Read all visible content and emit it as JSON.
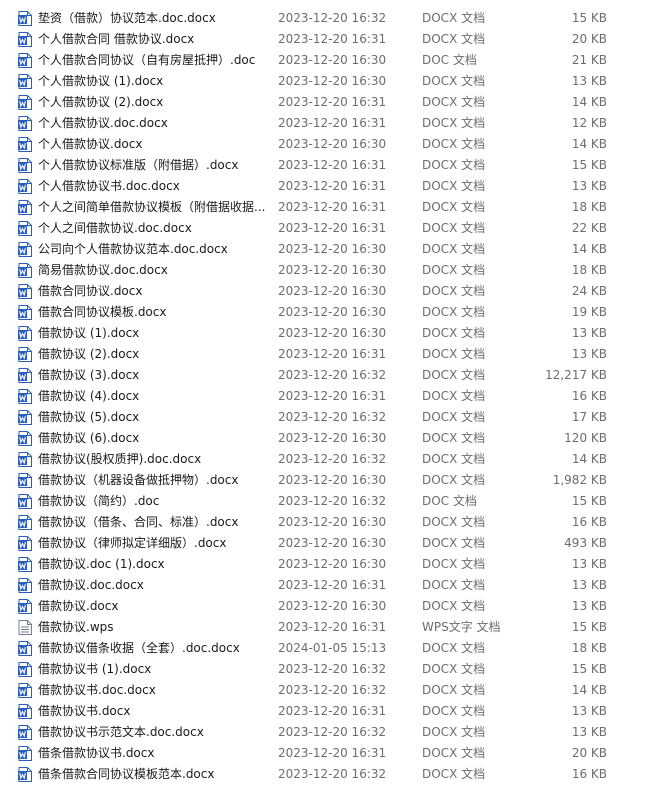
{
  "files": [
    {
      "name": "垫资（借款）协议范本.doc.docx",
      "date": "2023-12-20 16:32",
      "type": "DOCX 文档",
      "size": "15 KB",
      "icon": "word-document-icon"
    },
    {
      "name": "个人借款合同 借款协议.docx",
      "date": "2023-12-20 16:31",
      "type": "DOCX 文档",
      "size": "20 KB",
      "icon": "word-document-icon"
    },
    {
      "name": "个人借款合同协议（自有房屋抵押）.doc",
      "date": "2023-12-20 16:30",
      "type": "DOC 文档",
      "size": "21 KB",
      "icon": "word-document-icon"
    },
    {
      "name": "个人借款协议 (1).docx",
      "date": "2023-12-20 16:30",
      "type": "DOCX 文档",
      "size": "13 KB",
      "icon": "word-document-icon"
    },
    {
      "name": "个人借款协议 (2).docx",
      "date": "2023-12-20 16:31",
      "type": "DOCX 文档",
      "size": "14 KB",
      "icon": "word-document-icon"
    },
    {
      "name": "个人借款协议.doc.docx",
      "date": "2023-12-20 16:31",
      "type": "DOCX 文档",
      "size": "12 KB",
      "icon": "word-document-icon"
    },
    {
      "name": "个人借款协议.docx",
      "date": "2023-12-20 16:30",
      "type": "DOCX 文档",
      "size": "14 KB",
      "icon": "word-document-icon"
    },
    {
      "name": "个人借款协议标准版（附借据）.docx",
      "date": "2023-12-20 16:31",
      "type": "DOCX 文档",
      "size": "15 KB",
      "icon": "word-document-icon"
    },
    {
      "name": "个人借款协议书.doc.docx",
      "date": "2023-12-20 16:31",
      "type": "DOCX 文档",
      "size": "13 KB",
      "icon": "word-document-icon"
    },
    {
      "name": "个人之间简单借款协议模板（附借据收据...",
      "date": "2023-12-20 16:31",
      "type": "DOCX 文档",
      "size": "18 KB",
      "icon": "word-document-icon"
    },
    {
      "name": "个人之间借款协议.doc.docx",
      "date": "2023-12-20 16:31",
      "type": "DOCX 文档",
      "size": "22 KB",
      "icon": "word-document-icon"
    },
    {
      "name": "公司向个人借款协议范本.doc.docx",
      "date": "2023-12-20 16:30",
      "type": "DOCX 文档",
      "size": "14 KB",
      "icon": "word-document-icon"
    },
    {
      "name": "简易借款协议.doc.docx",
      "date": "2023-12-20 16:30",
      "type": "DOCX 文档",
      "size": "18 KB",
      "icon": "word-document-icon"
    },
    {
      "name": "借款合同协议.docx",
      "date": "2023-12-20 16:30",
      "type": "DOCX 文档",
      "size": "24 KB",
      "icon": "word-document-icon"
    },
    {
      "name": "借款合同协议模板.docx",
      "date": "2023-12-20 16:30",
      "type": "DOCX 文档",
      "size": "19 KB",
      "icon": "word-document-icon"
    },
    {
      "name": "借款协议 (1).docx",
      "date": "2023-12-20 16:30",
      "type": "DOCX 文档",
      "size": "13 KB",
      "icon": "word-document-icon"
    },
    {
      "name": "借款协议 (2).docx",
      "date": "2023-12-20 16:31",
      "type": "DOCX 文档",
      "size": "13 KB",
      "icon": "word-document-icon"
    },
    {
      "name": "借款协议 (3).docx",
      "date": "2023-12-20 16:32",
      "type": "DOCX 文档",
      "size": "12,217 KB",
      "icon": "word-document-icon"
    },
    {
      "name": "借款协议 (4).docx",
      "date": "2023-12-20 16:31",
      "type": "DOCX 文档",
      "size": "16 KB",
      "icon": "word-document-icon"
    },
    {
      "name": "借款协议 (5).docx",
      "date": "2023-12-20 16:32",
      "type": "DOCX 文档",
      "size": "17 KB",
      "icon": "word-document-icon"
    },
    {
      "name": "借款协议 (6).docx",
      "date": "2023-12-20 16:30",
      "type": "DOCX 文档",
      "size": "120 KB",
      "icon": "word-document-icon"
    },
    {
      "name": "借款协议(股权质押).doc.docx",
      "date": "2023-12-20 16:32",
      "type": "DOCX 文档",
      "size": "14 KB",
      "icon": "word-document-icon"
    },
    {
      "name": "借款协议（机器设备做抵押物）.docx",
      "date": "2023-12-20 16:30",
      "type": "DOCX 文档",
      "size": "1,982 KB",
      "icon": "word-document-icon"
    },
    {
      "name": "借款协议（简约）.doc",
      "date": "2023-12-20 16:32",
      "type": "DOC 文档",
      "size": "15 KB",
      "icon": "word-document-icon"
    },
    {
      "name": "借款协议（借条、合同、标准）.docx",
      "date": "2023-12-20 16:30",
      "type": "DOCX 文档",
      "size": "16 KB",
      "icon": "word-document-icon"
    },
    {
      "name": "借款协议（律师拟定详细版）.docx",
      "date": "2023-12-20 16:30",
      "type": "DOCX 文档",
      "size": "493 KB",
      "icon": "word-document-icon"
    },
    {
      "name": "借款协议.doc (1).docx",
      "date": "2023-12-20 16:30",
      "type": "DOCX 文档",
      "size": "13 KB",
      "icon": "word-document-icon"
    },
    {
      "name": "借款协议.doc.docx",
      "date": "2023-12-20 16:31",
      "type": "DOCX 文档",
      "size": "13 KB",
      "icon": "word-document-icon"
    },
    {
      "name": "借款协议.docx",
      "date": "2023-12-20 16:30",
      "type": "DOCX 文档",
      "size": "13 KB",
      "icon": "word-document-icon"
    },
    {
      "name": "借款协议.wps",
      "date": "2023-12-20 16:31",
      "type": "WPS文字 文档",
      "size": "15 KB",
      "icon": "text-document-icon"
    },
    {
      "name": "借款协议借条收据（全套）.doc.docx",
      "date": "2024-01-05 15:13",
      "type": "DOCX 文档",
      "size": "18 KB",
      "icon": "word-document-icon"
    },
    {
      "name": "借款协议书 (1).docx",
      "date": "2023-12-20 16:32",
      "type": "DOCX 文档",
      "size": "15 KB",
      "icon": "word-document-icon"
    },
    {
      "name": "借款协议书.doc.docx",
      "date": "2023-12-20 16:32",
      "type": "DOCX 文档",
      "size": "14 KB",
      "icon": "word-document-icon"
    },
    {
      "name": "借款协议书.docx",
      "date": "2023-12-20 16:31",
      "type": "DOCX 文档",
      "size": "13 KB",
      "icon": "word-document-icon"
    },
    {
      "name": "借款协议书示范文本.doc.docx",
      "date": "2023-12-20 16:32",
      "type": "DOCX 文档",
      "size": "13 KB",
      "icon": "word-document-icon"
    },
    {
      "name": "借条借款协议书.docx",
      "date": "2023-12-20 16:31",
      "type": "DOCX 文档",
      "size": "20 KB",
      "icon": "word-document-icon"
    },
    {
      "name": "借条借款合同协议模板范本.docx",
      "date": "2023-12-20 16:32",
      "type": "DOCX 文档",
      "size": "16 KB",
      "icon": "word-document-icon"
    }
  ],
  "colors": {
    "word_icon": "#2b5eb8",
    "text_icon": "#6f7f95",
    "name_text": "#1a1a1a",
    "meta_text": "#6d6d6d"
  }
}
